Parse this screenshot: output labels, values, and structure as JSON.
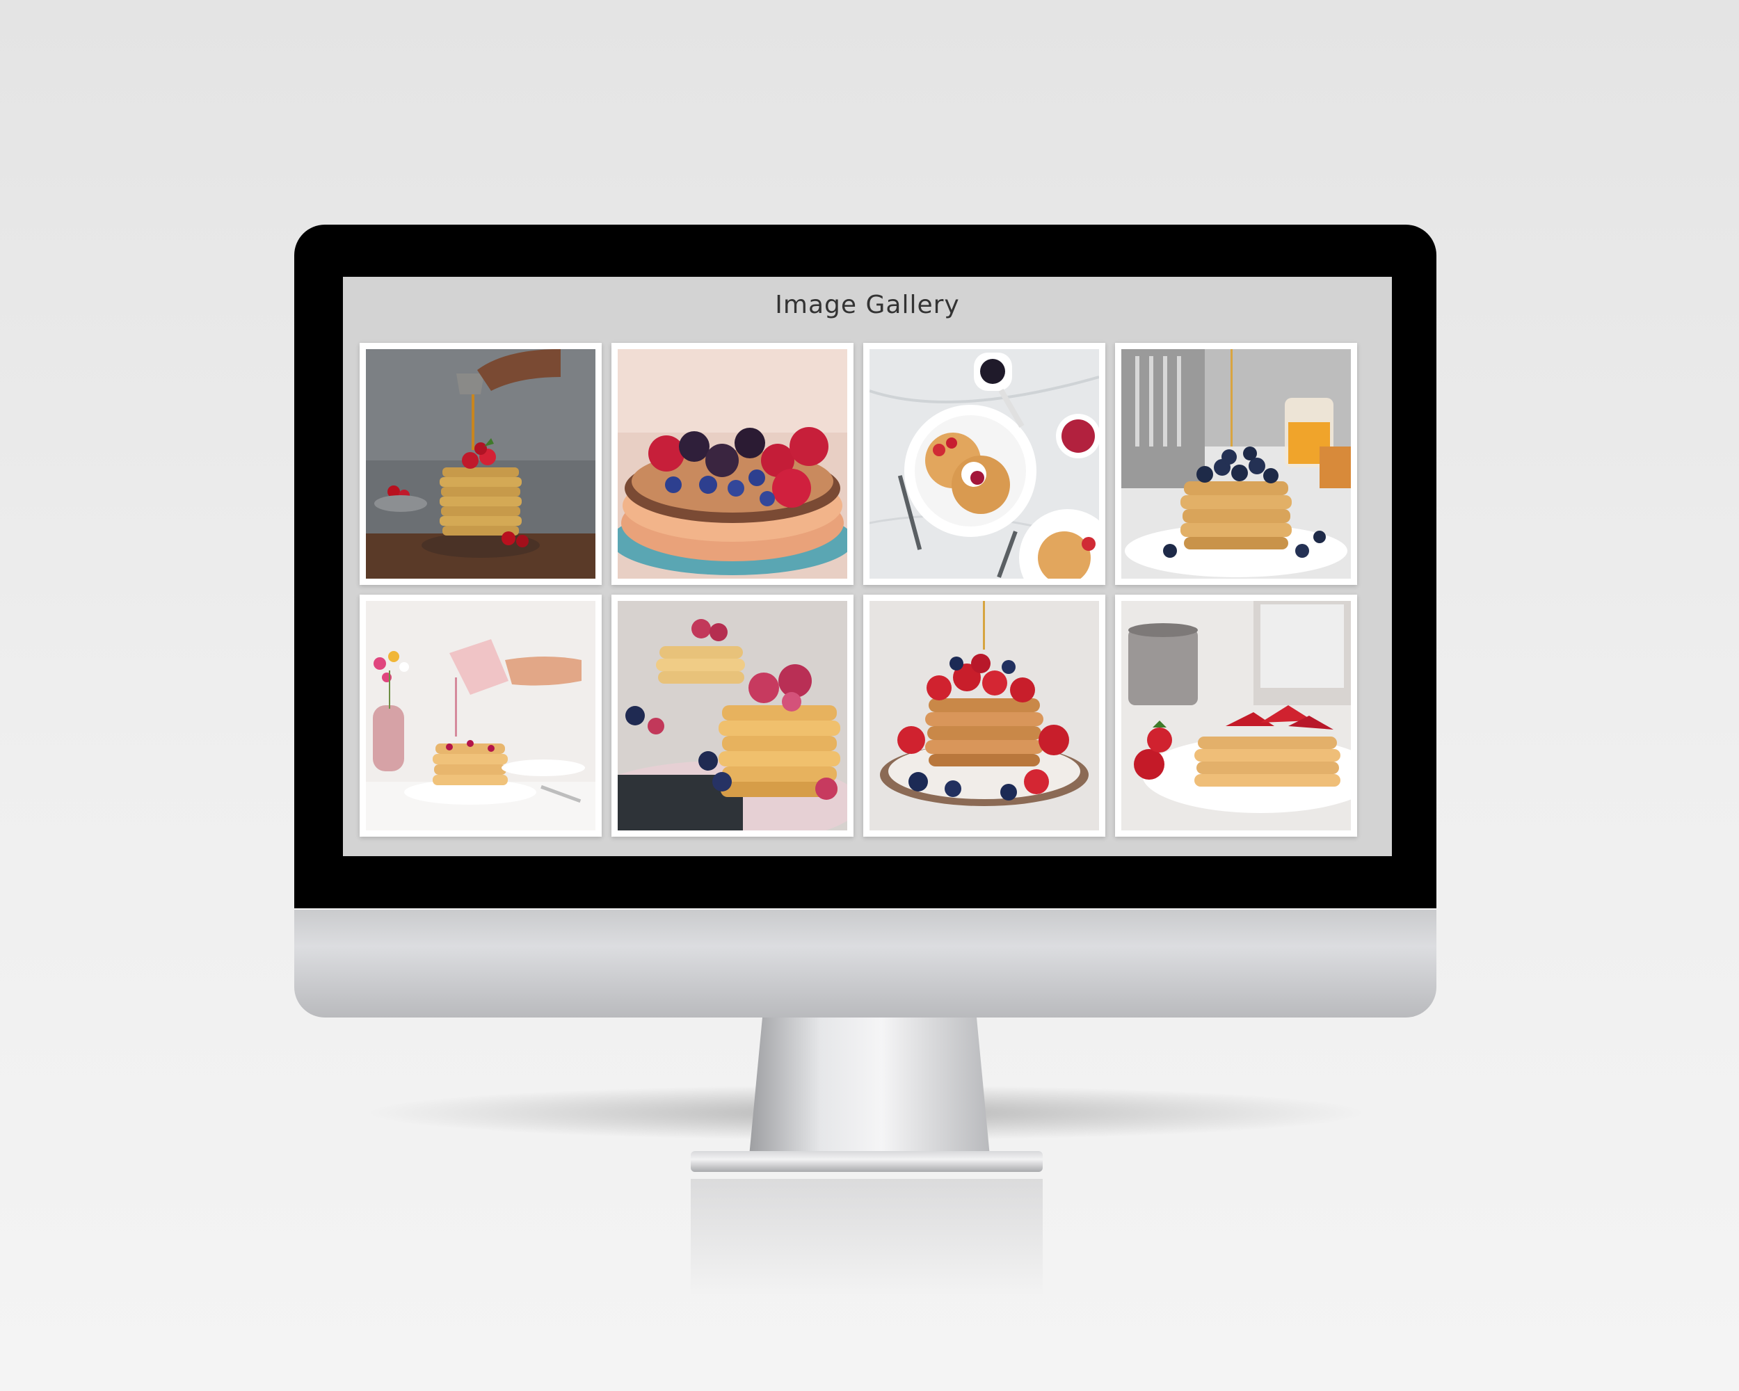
{
  "gallery": {
    "title": "Image Gallery",
    "images": [
      {
        "icon": "pancake-stack-syrup-pour-photo"
      },
      {
        "icon": "pancakes-with-berries-photo"
      },
      {
        "icon": "pancakes-plate-with-jam-photo"
      },
      {
        "icon": "pancakes-blueberries-honey-photo"
      },
      {
        "icon": "pancakes-pink-syrup-pour-photo"
      },
      {
        "icon": "pancake-stack-raspberries-photo"
      },
      {
        "icon": "pancakes-strawberries-syrup-photo"
      },
      {
        "icon": "pancakes-strawberries-coffee-photo"
      }
    ]
  },
  "colors": {
    "screen_background": "#d3d3d3",
    "bezel": "#000000",
    "title_text": "#333333"
  }
}
